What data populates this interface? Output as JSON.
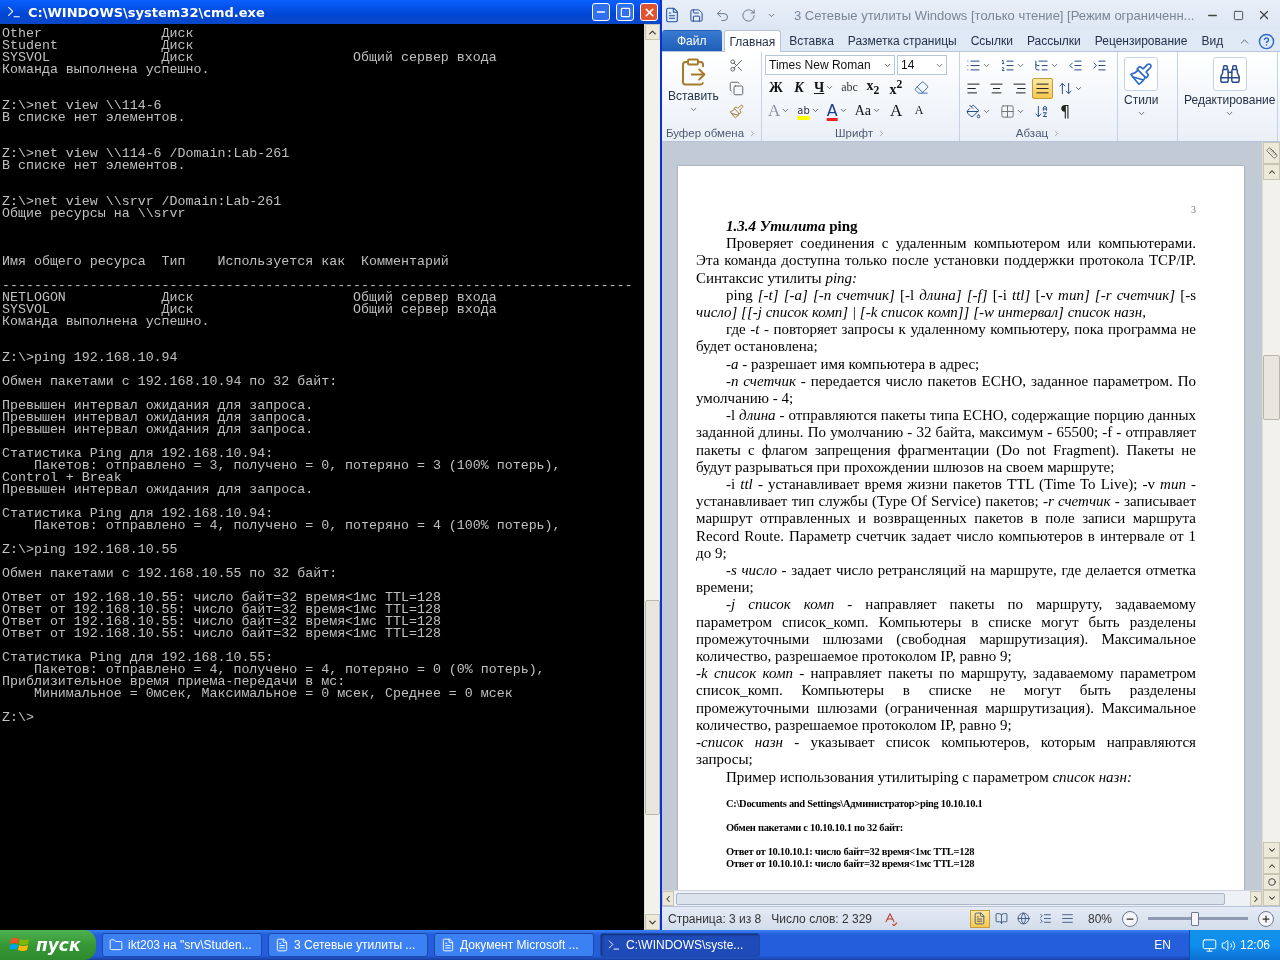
{
  "cmd": {
    "title": "C:\\WINDOWS\\system32\\cmd.exe",
    "lines": [
      {
        "kind": "text",
        "text": "Other               Диск"
      },
      {
        "kind": "text",
        "text": "Student             Диск"
      },
      {
        "kind": "text",
        "text": "SYSVOL              Диск                    Общий сервер входа"
      },
      {
        "kind": "text",
        "text": "Команда выполнена успешно."
      },
      {
        "kind": "blank"
      },
      {
        "kind": "blank"
      },
      {
        "kind": "text",
        "text": "Z:\\>net view \\\\114-6"
      },
      {
        "kind": "text",
        "text": "В списке нет элементов."
      },
      {
        "kind": "blank"
      },
      {
        "kind": "blank"
      },
      {
        "kind": "text",
        "text": "Z:\\>net view \\\\114-6 /Domain:Lab-261"
      },
      {
        "kind": "text",
        "text": "В списке нет элементов."
      },
      {
        "kind": "blank"
      },
      {
        "kind": "blank"
      },
      {
        "kind": "text",
        "text": "Z:\\>net view \\\\srvr /Domain:Lab-261"
      },
      {
        "kind": "text",
        "text": "Общие ресурсы на \\\\srvr"
      },
      {
        "kind": "blank"
      },
      {
        "kind": "blank"
      },
      {
        "kind": "blank"
      },
      {
        "kind": "text",
        "text": "Имя общего ресурса  Тип    Используется как  Комментарий"
      },
      {
        "kind": "blank"
      },
      {
        "kind": "text",
        "text": "-------------------------------------------------------------------------------"
      },
      {
        "kind": "text",
        "text": "NETLOGON            Диск                    Общий сервер входа"
      },
      {
        "kind": "text",
        "text": "SYSVOL              Диск                    Общий сервер входа"
      },
      {
        "kind": "text",
        "text": "Команда выполнена успешно."
      },
      {
        "kind": "blank"
      },
      {
        "kind": "blank"
      },
      {
        "kind": "text",
        "text": "Z:\\>ping 192.168.10.94"
      },
      {
        "kind": "blank"
      },
      {
        "kind": "text",
        "text": "Обмен пакетами с 192.168.10.94 по 32 байт:"
      },
      {
        "kind": "blank"
      },
      {
        "kind": "text",
        "text": "Превышен интервал ожидания для запроса."
      },
      {
        "kind": "text",
        "text": "Превышен интервал ожидания для запроса."
      },
      {
        "kind": "text",
        "text": "Превышен интервал ожидания для запроса."
      },
      {
        "kind": "blank"
      },
      {
        "kind": "text",
        "text": "Статистика Ping для 192.168.10.94:"
      },
      {
        "kind": "text",
        "text": "    Пакетов: отправлено = 3, получено = 0, потеряно = 3 (100% потерь),"
      },
      {
        "kind": "text",
        "text": "Control + Break"
      },
      {
        "kind": "text",
        "text": "Превышен интервал ожидания для запроса."
      },
      {
        "kind": "blank"
      },
      {
        "kind": "text",
        "text": "Статистика Ping для 192.168.10.94:"
      },
      {
        "kind": "text",
        "text": "    Пакетов: отправлено = 4, получено = 0, потеряно = 4 (100% потерь),"
      },
      {
        "kind": "blank"
      },
      {
        "kind": "text",
        "text": "Z:\\>ping 192.168.10.55"
      },
      {
        "kind": "blank"
      },
      {
        "kind": "text",
        "text": "Обмен пакетами с 192.168.10.55 по 32 байт:"
      },
      {
        "kind": "blank"
      },
      {
        "kind": "text",
        "text": "Ответ от 192.168.10.55: число байт=32 время<1мс TTL=128"
      },
      {
        "kind": "text",
        "text": "Ответ от 192.168.10.55: число байт=32 время<1мс TTL=128"
      },
      {
        "kind": "text",
        "text": "Ответ от 192.168.10.55: число байт=32 время<1мс TTL=128"
      },
      {
        "kind": "text",
        "text": "Ответ от 192.168.10.55: число байт=32 время<1мс TTL=128"
      },
      {
        "kind": "blank"
      },
      {
        "kind": "text",
        "text": "Статистика Ping для 192.168.10.55:"
      },
      {
        "kind": "text",
        "text": "    Пакетов: отправлено = 4, получено = 4, потеряно = 0 (0% потерь),"
      },
      {
        "kind": "text",
        "text": "Приблизительное время приема-передачи в мс:"
      },
      {
        "kind": "text",
        "text": "    Минимальное = 0мсек, Максимальное = 0 мсек, Среднее = 0 мсек"
      },
      {
        "kind": "blank"
      },
      {
        "kind": "text",
        "text": "Z:\\>"
      }
    ]
  },
  "word": {
    "title": "3 Сетевые утилиты Windows [только чтение] [Режим ограниченн...",
    "tabs": [
      {
        "kind": "file",
        "label": "Файл",
        "selected": false
      },
      {
        "kind": "tab",
        "label": "Главная",
        "selected": true
      },
      {
        "kind": "tab",
        "label": "Вставка",
        "selected": false
      },
      {
        "kind": "tab",
        "label": "Разметка страницы",
        "selected": false
      },
      {
        "kind": "tab",
        "label": "Ссылки",
        "selected": false
      },
      {
        "kind": "tab",
        "label": "Рассылки",
        "selected": false
      },
      {
        "kind": "tab",
        "label": "Рецензирование",
        "selected": false
      },
      {
        "kind": "tab",
        "label": "Вид",
        "selected": false
      }
    ],
    "ribbon": {
      "clipboard": {
        "paste": "Вставить",
        "label": "Буфер обмена"
      },
      "font": {
        "label": "Шрифт",
        "name": "Times New Roman",
        "size": "14",
        "row1": [
          {
            "kind": "bold",
            "label": "Ж"
          },
          {
            "kind": "italic",
            "label": "К"
          },
          {
            "kind": "underline",
            "label": "Ч"
          },
          {
            "kind": "strike",
            "label": "abc"
          },
          {
            "kind": "sub",
            "label": "x$_{2}$"
          },
          {
            "kind": "sup",
            "label": "x$^{2}$"
          }
        ],
        "row2": [
          {
            "kind": "effects",
            "label": "A"
          },
          {
            "kind": "highlight",
            "label": "ab"
          },
          {
            "kind": "color",
            "label": "A"
          },
          {
            "kind": "case",
            "label": "Aa"
          },
          {
            "kind": "grow",
            "label": "A"
          },
          {
            "kind": "shrink",
            "label": "A"
          }
        ]
      },
      "paragraph": {
        "label": "Абзац",
        "marks": "¶",
        "align": [
          {
            "kind": "left",
            "selected": false
          },
          {
            "kind": "center",
            "selected": false
          },
          {
            "kind": "right",
            "selected": false
          },
          {
            "kind": "justify",
            "selected": true
          }
        ]
      },
      "styles": {
        "label": "Стили"
      },
      "editing": {
        "label": "Редактирование"
      }
    },
    "page": {
      "number": "3",
      "paragraphs": [
        {
          "kind": "heading",
          "text": "*1.3.4 Утилита* ping"
        },
        {
          "kind": "indented",
          "text": "Проверяет соединения с удаленным компьютером или компьютерами. Эта команда доступна только после установки поддержки протокола TCP/IP. Синтаксис утилиты *ping:*"
        },
        {
          "kind": "indented",
          "text": "ping *[-t] [-a] [-n счетчик]* [-l *длина] [-f]* [-i *ttl]* [-v *тип] [-r счетчик]* [-s *число] [[-j список комп] | [-k список комп]] [-w интервал] список назн,*"
        },
        {
          "kind": "indented",
          "text": "где *-t* - повторяет запросы к удаленному компьютеру, пока программа не будет остановлена;"
        },
        {
          "kind": "indented",
          "text": "*-a* - разрешает имя компьютера в адрес;"
        },
        {
          "kind": "indented",
          "text": "*-n счетчик* - передается число пакетов ECHO, заданное параметром. По умолчанию - 4;"
        },
        {
          "kind": "indented",
          "text": "-l *длина* - отправляются пакеты типа ECHO, содержащие порцию данных заданной длины. По умолчанию - 32 байта, максимум - 65500; -f - отправляет пакеты с флагом запрещения фрагментации (Do not Fragment). Пакеты не будут разрываться при прохождении шлюзов на своем маршруте;"
        },
        {
          "kind": "indented",
          "text": "-i *ttl* - устанавливает время жизни пакетов TTL (Time To Live); -v *тип* - устанавливает тип службы (Type Of Service) пакетов; *-r счетчик* - записывает маршрут отправленных и возвращенных пакетов в поле записи маршрута Record Route. Параметр счетчик задает число компьютеров в интервале от 1 до 9;"
        },
        {
          "kind": "indented",
          "text": "*-s число* - задает число ретрансляций на маршруте, где делается отметка времени;"
        },
        {
          "kind": "indented",
          "text": "*-j список комп* - направляет пакеты по маршруту, задаваемому параметром список_комп. Компьютеры в списке могут быть разделены промежуточными шлюзами (свободная маршрутизация). Максимальное количество, разрешаемое протоколом IP, равно 9;"
        },
        {
          "kind": "flush",
          "text": "*-k список комп* - направляет пакеты по маршруту, задаваемому параметром список_комп. Компьютеры в списке не могут быть разделены промежуточными шлюзами (ограниченная маршрутизация). Максимальное количество, разрешаемое протоколом IP, равно 9;"
        },
        {
          "kind": "flush",
          "text": "-*список назн* - указывает список компьютеров, которым направляются запросы;"
        },
        {
          "kind": "indented",
          "text": "Пример использования утилитыping с параметром *список назн:*"
        },
        {
          "kind": "code",
          "text": "C:\\Documents and Settings\\Администратор>ping 10.10.10.1"
        },
        {
          "kind": "code",
          "text": "Обмен пакетами с 10.10.10.1 по 32 байт:"
        },
        {
          "kind": "code",
          "text": "Ответ от 10.10.10.1: число байт=32 время<1мс TTL=128"
        },
        {
          "kind": "code_next",
          "text": "Ответ от 10.10.10.1: число байт=32 время<1мс TTL=128"
        }
      ]
    },
    "status": {
      "page": "Страница: 3 из 8",
      "words": "Число слов: 2 329",
      "zoom": "80%",
      "zoom_slider": {
        "level": 0.47
      },
      "views": [
        {
          "kind": "print",
          "selected": true
        },
        {
          "kind": "reading",
          "selected": false
        },
        {
          "kind": "web",
          "selected": false
        },
        {
          "kind": "outline",
          "selected": false
        },
        {
          "kind": "draft",
          "selected": false
        }
      ]
    }
  },
  "taskbar": {
    "start": "пуск",
    "tasks": [
      {
        "kind": "folder",
        "label": "ikt203 на \"srv\\Studen...",
        "selected": false
      },
      {
        "kind": "word",
        "label": "3 Сетевые утилиты ...",
        "selected": false
      },
      {
        "kind": "word",
        "label": "Документ Microsoft ...",
        "selected": false
      },
      {
        "kind": "cmd",
        "label": "C:\\WINDOWS\\syste...",
        "selected": true
      }
    ],
    "language": "EN",
    "clock": "12:06"
  }
}
